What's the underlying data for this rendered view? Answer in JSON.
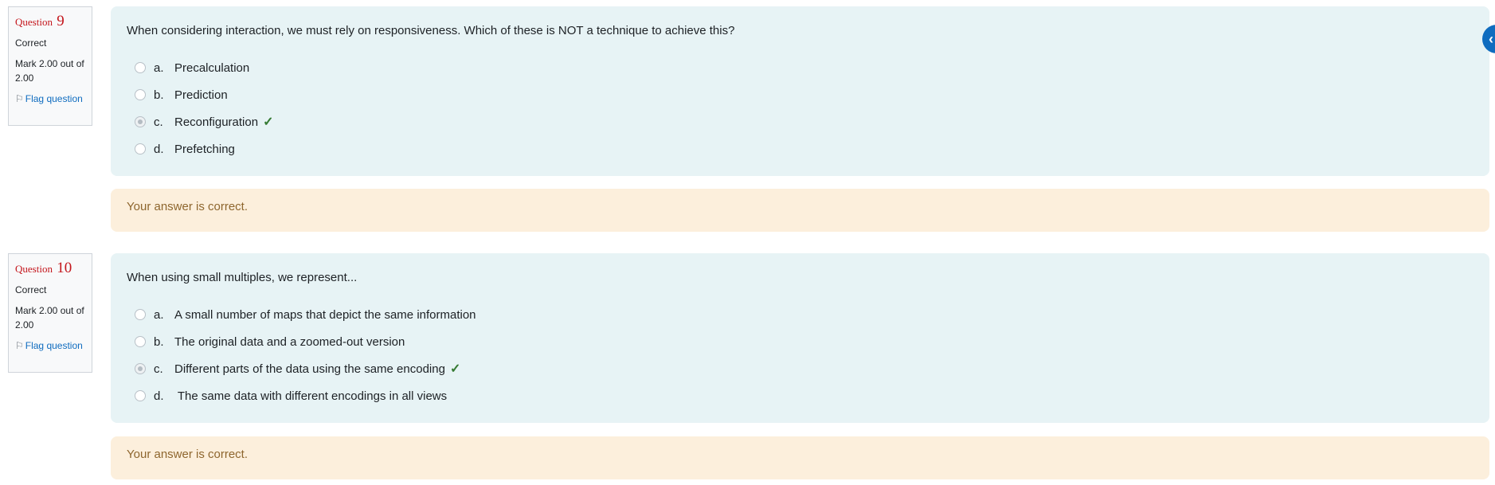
{
  "questions": [
    {
      "label": "Question",
      "number": "9",
      "state": "Correct",
      "grade": "Mark 2.00 out of 2.00",
      "flag": "Flag question",
      "text": "When considering interaction, we must rely on responsiveness. Which of these is NOT a technique to achieve this?",
      "options": [
        {
          "letter": "a.",
          "text": "Precalculation"
        },
        {
          "letter": "b.",
          "text": "Prediction"
        },
        {
          "letter": "c.",
          "text": "Reconfiguration"
        },
        {
          "letter": "d.",
          "text": "Prefetching"
        }
      ],
      "selected_index": 2,
      "feedback": "Your answer is correct."
    },
    {
      "label": "Question",
      "number": "10",
      "state": "Correct",
      "grade": "Mark 2.00 out of 2.00",
      "flag": "Flag question",
      "text": "When using small multiples, we represent...",
      "options": [
        {
          "letter": "a.",
          "text": "A small number of maps that depict the same information"
        },
        {
          "letter": "b.",
          "text": "The original data and a zoomed-out version"
        },
        {
          "letter": "c.",
          "text": "Different parts of the data using the same encoding"
        },
        {
          "letter": "d.",
          "text": " The same data with different encodings in all views"
        }
      ],
      "selected_index": 2,
      "feedback": "Your answer is correct."
    }
  ],
  "icons": {
    "flag": "flag-icon",
    "tick": "check-icon",
    "drawer": "chevron-left-icon"
  },
  "colors": {
    "question_number": "#c4161c",
    "formulation_bg": "#e7f3f5",
    "feedback_bg": "#fcefdc",
    "feedback_text": "#8e662e",
    "link": "#0f6cbf",
    "correct": "#357a32"
  }
}
